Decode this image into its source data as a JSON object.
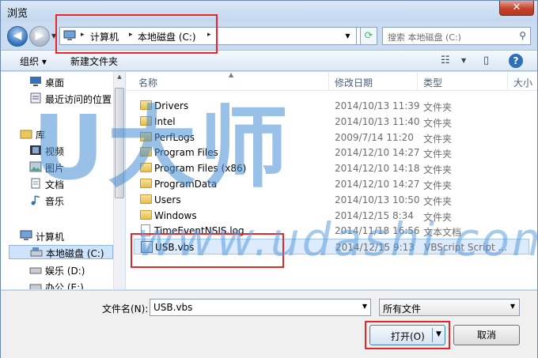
{
  "window": {
    "title": "浏览",
    "close_glyph": "✕"
  },
  "nav": {
    "back_glyph": "◀",
    "fwd_glyph": "▶"
  },
  "address": {
    "crumbs": [
      "计算机",
      "本地磁盘 (C:)"
    ],
    "sep_glyph": "▸",
    "search_placeholder": "搜索 本地磁盘 (C:)"
  },
  "toolbar": {
    "organize": "组织 ▾",
    "new_folder": "新建文件夹"
  },
  "sidebar": {
    "items": [
      {
        "label": "桌面",
        "icon": "desktop-icon"
      },
      {
        "label": "最近访问的位置",
        "icon": "recent-icon"
      },
      {
        "label": "库",
        "icon": "library-icon"
      },
      {
        "label": "视频",
        "icon": "video-icon"
      },
      {
        "label": "图片",
        "icon": "picture-icon"
      },
      {
        "label": "文档",
        "icon": "document-icon"
      },
      {
        "label": "音乐",
        "icon": "music-icon"
      },
      {
        "label": "计算机",
        "icon": "computer-icon"
      },
      {
        "label": "本地磁盘 (C:)",
        "icon": "drive-icon"
      },
      {
        "label": "娱乐 (D:)",
        "icon": "drive-icon"
      },
      {
        "label": "办公 (E:)",
        "icon": "drive-icon"
      }
    ]
  },
  "columns": {
    "name": "名称",
    "date": "修改日期",
    "type": "类型",
    "size": "大小"
  },
  "files": [
    {
      "name": "Drivers",
      "date": "2014/10/13 11:39",
      "type": "文件夹",
      "kind": "folder"
    },
    {
      "name": "Intel",
      "date": "2014/10/13 11:40",
      "type": "文件夹",
      "kind": "folder"
    },
    {
      "name": "PerfLogs",
      "date": "2009/7/14 11:20",
      "type": "文件夹",
      "kind": "folder"
    },
    {
      "name": "Program Files",
      "date": "2014/12/10 14:27",
      "type": "文件夹",
      "kind": "folder"
    },
    {
      "name": "Program Files (x86)",
      "date": "2014/12/10 14:18",
      "type": "文件夹",
      "kind": "folder"
    },
    {
      "name": "ProgramData",
      "date": "2014/12/10 14:27",
      "type": "文件夹",
      "kind": "folder"
    },
    {
      "name": "Users",
      "date": "2014/10/13 10:50",
      "type": "文件夹",
      "kind": "folder"
    },
    {
      "name": "Windows",
      "date": "2014/12/15 8:34",
      "type": "文件夹",
      "kind": "folder"
    },
    {
      "name": "TimeEventNSIS.log",
      "date": "2014/11/18 16:56",
      "type": "文本文档",
      "kind": "file"
    },
    {
      "name": "USB.vbs",
      "date": "2014/12/15 9:13",
      "type": "VBScript Script ...",
      "kind": "script"
    }
  ],
  "bottom": {
    "filename_label": "文件名(N):",
    "filename_value": "USB.vbs",
    "filter_value": "所有文件",
    "open_label": "打开(O)",
    "cancel_label": "取消"
  },
  "watermark": {
    "big": "U大师",
    "url": "www.udashi.com"
  },
  "colors": {
    "accent": "#2f6fb8",
    "highlight_red": "#e8262a"
  }
}
